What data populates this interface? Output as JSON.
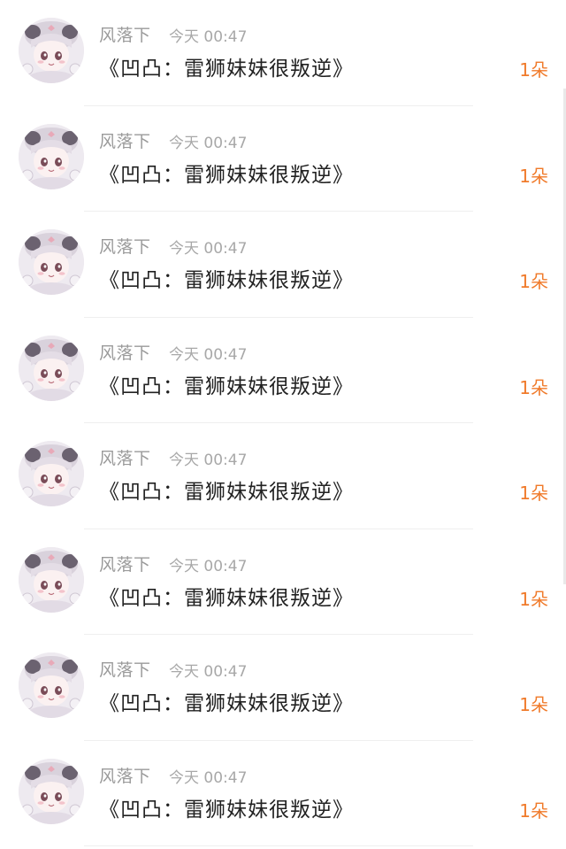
{
  "items": [
    {
      "name": "风落下",
      "time": "今天 00:47",
      "title": "《凹凸：雷狮妹妹很叛逆》",
      "count": "1朵",
      "avatar_icon": "anime-girl-avatar"
    },
    {
      "name": "风落下",
      "time": "今天 00:47",
      "title": "《凹凸：雷狮妹妹很叛逆》",
      "count": "1朵",
      "avatar_icon": "anime-girl-avatar"
    },
    {
      "name": "风落下",
      "time": "今天 00:47",
      "title": "《凹凸：雷狮妹妹很叛逆》",
      "count": "1朵",
      "avatar_icon": "anime-girl-avatar"
    },
    {
      "name": "风落下",
      "time": "今天 00:47",
      "title": "《凹凸：雷狮妹妹很叛逆》",
      "count": "1朵",
      "avatar_icon": "anime-girl-avatar"
    },
    {
      "name": "风落下",
      "time": "今天 00:47",
      "title": "《凹凸：雷狮妹妹很叛逆》",
      "count": "1朵",
      "avatar_icon": "anime-girl-avatar"
    },
    {
      "name": "风落下",
      "time": "今天 00:47",
      "title": "《凹凸：雷狮妹妹很叛逆》",
      "count": "1朵",
      "avatar_icon": "anime-girl-avatar"
    },
    {
      "name": "风落下",
      "time": "今天 00:47",
      "title": "《凹凸：雷狮妹妹很叛逆》",
      "count": "1朵",
      "avatar_icon": "anime-girl-avatar"
    },
    {
      "name": "风落下",
      "time": "今天 00:47",
      "title": "《凹凸：雷狮妹妹很叛逆》",
      "count": "1朵",
      "avatar_icon": "anime-girl-avatar"
    }
  ],
  "colors": {
    "accent": "#f07a2a",
    "name_text": "#9a9a9a",
    "title_text": "#222222",
    "divider": "#efefef"
  }
}
